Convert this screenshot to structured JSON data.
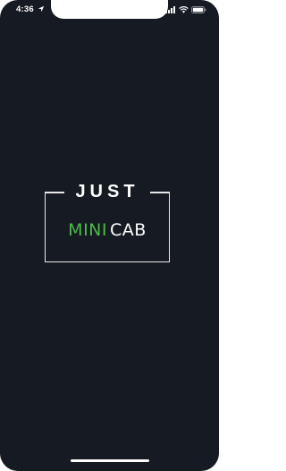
{
  "status_bar": {
    "time": "4:36",
    "location_icon": "location-arrow-icon",
    "signal_icon": "cellular-signal-icon",
    "wifi_icon": "wifi-icon",
    "battery_icon": "battery-icon"
  },
  "splash": {
    "brand_top": "JUST",
    "brand_mini": "MINI",
    "brand_cab": "CAB"
  },
  "colors": {
    "background": "#161a22",
    "accent_green": "#4cbb4a",
    "text": "#ffffff"
  }
}
